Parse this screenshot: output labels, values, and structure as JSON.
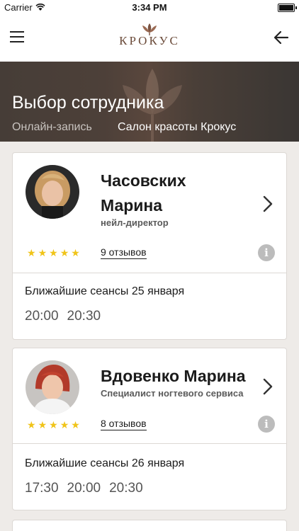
{
  "status_bar": {
    "carrier": "Carrier",
    "time": "3:34 PM"
  },
  "nav": {
    "logo_text": "КРОКУС"
  },
  "hero": {
    "title": "Выбор сотрудника",
    "breadcrumb_1": "Онлайн-запись",
    "breadcrumb_2": "Салон красоты Крокус"
  },
  "staff": [
    {
      "name_line1": "Часовских",
      "name_line2": "Марина",
      "role": "нейл-директор",
      "rating": 5,
      "reviews": "9 отзывов",
      "sessions_title": "Ближайшие сеансы 25 января",
      "slots": [
        "20:00",
        "20:30"
      ]
    },
    {
      "name_line1": "Вдовенко Марина",
      "role": "Специалист ногтевого сервиса",
      "rating": 5,
      "reviews": "8 отзывов",
      "sessions_title": "Ближайшие сеансы 26 января",
      "slots": [
        "17:30",
        "20:00",
        "20:30"
      ]
    }
  ],
  "colors": {
    "star": "#f0c419",
    "hero_bg": "#463d37",
    "logo": "#6b4b3a"
  }
}
